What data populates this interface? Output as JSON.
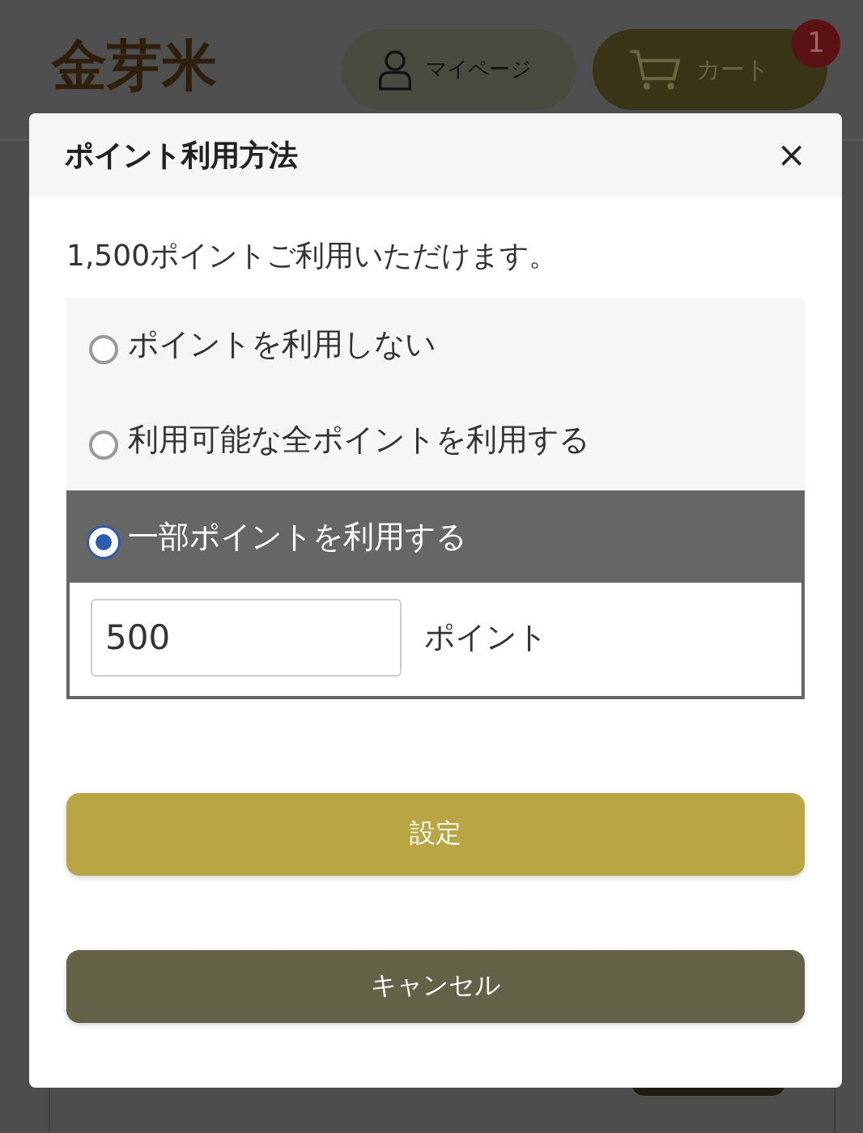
{
  "header": {
    "logo": "金芽米",
    "mypage_button": "マイページ",
    "cart_button": {
      "label": "カート",
      "badge": "1"
    }
  },
  "modal": {
    "title": "ポイント利用方法",
    "close": "×",
    "message": "1,500ポイントご利用いただけます。",
    "options": [
      {
        "label": "ポイントを利用しない",
        "selected": false
      },
      {
        "label": "利用可能な全ポイントを利用する",
        "selected": false
      },
      {
        "label": "一部ポイントを利用する",
        "selected": true
      }
    ],
    "points_input": {
      "value": "500",
      "unit": "ポイント"
    },
    "buttons": [
      {
        "label": "設定",
        "kind": "primary"
      },
      {
        "label": "キャンセル",
        "kind": "secondary"
      }
    ]
  }
}
